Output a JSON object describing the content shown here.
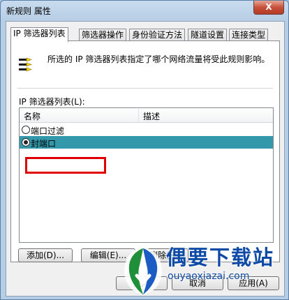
{
  "window": {
    "title": "新规则 属性",
    "close_label": "X"
  },
  "tabs": [
    {
      "label": "IP 筛选器列表",
      "active": true
    },
    {
      "label": "筛选器操作",
      "active": false
    },
    {
      "label": "身份验证方法",
      "active": false
    },
    {
      "label": "隧道设置",
      "active": false
    },
    {
      "label": "连接类型",
      "active": false
    }
  ],
  "panel": {
    "description": "所选的 IP 筛选器列表指定了哪个网络流量将受此规则影响。",
    "list_label": "IP 筛选器列表(L):",
    "columns": {
      "name": "名称",
      "description": "描述"
    },
    "rows": [
      {
        "name": "端口过滤",
        "description": "",
        "checked": false,
        "selected": false
      },
      {
        "name": "封端口",
        "description": "",
        "checked": true,
        "selected": true
      }
    ]
  },
  "buttons": {
    "add": "添加(D)...",
    "edit": "编辑(E)...",
    "delete": "删除(R)",
    "close": "关闭",
    "cancel": "取消",
    "apply": "应用(A)"
  },
  "watermark": {
    "brand_cn": "偶要下载站",
    "brand_en": "ouyaoxiazai.com"
  },
  "colors": {
    "selection": "#3399aa",
    "annotation_box": "#e00000",
    "watermark": "#0d4aa6"
  }
}
